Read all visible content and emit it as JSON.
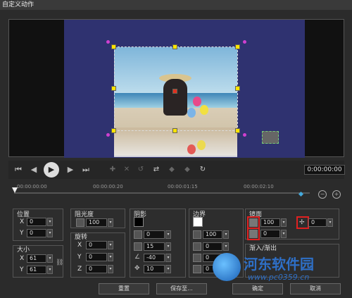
{
  "window": {
    "title": "自定义动作"
  },
  "transport": {
    "timecode": "0:00:00:00"
  },
  "ruler": {
    "ticks": [
      "00:00:00:00",
      "00:00:00:20",
      "00:00:01:15",
      "00:00:02:10"
    ]
  },
  "panels": {
    "position": {
      "label": "位置",
      "x_label": "X",
      "x_value": "0",
      "y_label": "Y",
      "y_value": "0"
    },
    "size": {
      "label": "大小",
      "x_label": "X",
      "x_value": "61",
      "y_label": "Y",
      "y_value": "61"
    },
    "opacity": {
      "label": "阻光度",
      "value": "100"
    },
    "rotation": {
      "label": "旋转",
      "x_label": "X",
      "x_value": "0",
      "y_label": "Y",
      "y_value": "0",
      "z_label": "Z",
      "z_value": "0"
    },
    "shadow": {
      "label": "阴影",
      "value1": "0",
      "value2": "15",
      "value3": "-40",
      "value4": "10"
    },
    "border": {
      "label": "边界",
      "value1": "100",
      "value2": "0",
      "value3": "0",
      "value4": "0"
    },
    "mirror": {
      "label": "镜面",
      "value1": "100",
      "value2": "0",
      "value3": "0"
    },
    "fade": {
      "label": "渐入/渐出"
    }
  },
  "buttons": {
    "reset": "重置",
    "save_to": "保存至...",
    "ok": "确定",
    "cancel": "取消"
  },
  "watermark": {
    "name": "河东软件园",
    "url": "www.pc0359.cn"
  }
}
